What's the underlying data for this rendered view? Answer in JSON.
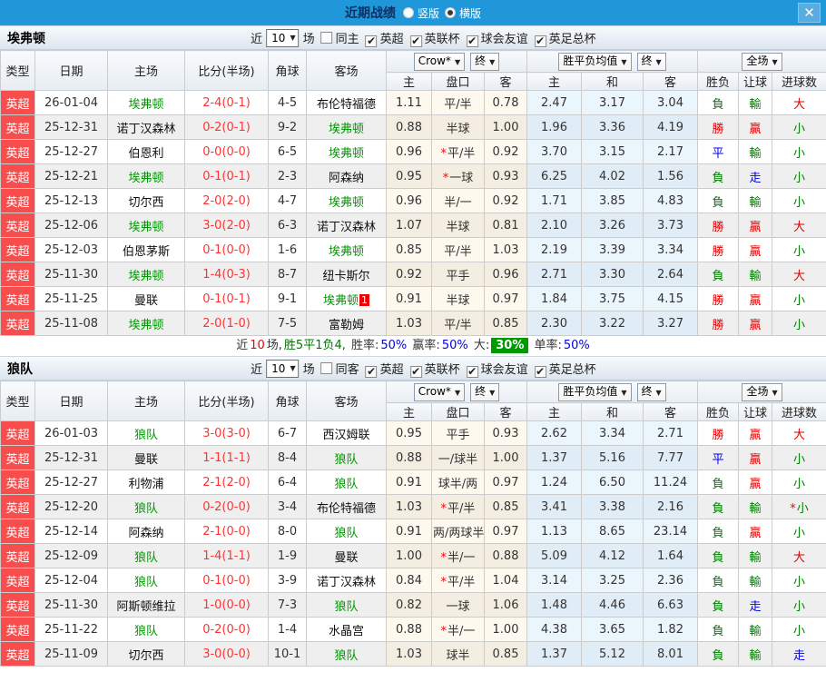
{
  "titlebar": {
    "title": "近期战绩",
    "vertical_label": "竖版",
    "horizontal_label": "横版",
    "selected_layout": "横版"
  },
  "glyphs": {
    "dropdown_arrow": "▼",
    "check": "✔",
    "close": "✕"
  },
  "filters": {
    "near_label": "近",
    "games_label": "场"
  },
  "table_header": {
    "type": "类型",
    "date": "日期",
    "home": "主场",
    "score": "比分(半场)",
    "corner": "角球",
    "away": "客场",
    "odds_source": "Crow*",
    "final_label": "终",
    "avg_label": "胜平负均值",
    "full_label": "全场",
    "home_odds": "主",
    "handicap": "盘口",
    "away_odds": "客",
    "home_avg": "主",
    "draw_avg": "和",
    "away_avg": "客",
    "result": "胜负",
    "handicap_result": "让球",
    "goals": "进球数"
  },
  "colors": {
    "titlebar_blue": "#1f97d8",
    "type_red": "#f84d4d",
    "focus_team": "#009900",
    "score_red": "#ff3333",
    "result_colors": {
      "勝": "#e60000",
      "贏": "#e60000",
      "大": "#e60000",
      "平": "#0000ee",
      "走": "#0000ee",
      "負": "#008000",
      "輸": "#008000",
      "小": "#008000"
    }
  },
  "sections": [
    {
      "team": "埃弗顿",
      "games_count": "10",
      "same_label": "同主",
      "same_checked": false,
      "leagues": [
        "英超",
        "英联杯",
        "球会友谊",
        "英足总杯"
      ],
      "rows": [
        {
          "t": "英超",
          "d": "26-01-04",
          "h": "埃弗顿",
          "hf": true,
          "s": "2-4(0-1)",
          "c": "4-5",
          "a": "布伦特福德",
          "af": false,
          "o1": "1.11",
          "hc": "平/半",
          "hs": false,
          "o2": "0.78",
          "m1": "2.47",
          "m2": "3.17",
          "m3": "3.04",
          "r1": "負",
          "r2": "輸",
          "r3": "大",
          "r3s": false
        },
        {
          "t": "英超",
          "d": "25-12-31",
          "h": "诺丁汉森林",
          "hf": false,
          "s": "0-2(0-1)",
          "c": "9-2",
          "a": "埃弗顿",
          "af": true,
          "o1": "0.88",
          "hc": "半球",
          "hs": false,
          "o2": "1.00",
          "m1": "1.96",
          "m2": "3.36",
          "m3": "4.19",
          "r1": "勝",
          "r2": "贏",
          "r3": "小",
          "r3s": false
        },
        {
          "t": "英超",
          "d": "25-12-27",
          "h": "伯恩利",
          "hf": false,
          "s": "0-0(0-0)",
          "c": "6-5",
          "a": "埃弗顿",
          "af": true,
          "o1": "0.96",
          "hc": "平/半",
          "hs": true,
          "o2": "0.92",
          "m1": "3.70",
          "m2": "3.15",
          "m3": "2.17",
          "r1": "平",
          "r2": "輸",
          "r3": "小",
          "r3s": false
        },
        {
          "t": "英超",
          "d": "25-12-21",
          "h": "埃弗顿",
          "hf": true,
          "s": "0-1(0-1)",
          "c": "2-3",
          "a": "阿森纳",
          "af": false,
          "o1": "0.95",
          "hc": "一球",
          "hs": true,
          "o2": "0.93",
          "m1": "6.25",
          "m2": "4.02",
          "m3": "1.56",
          "r1": "負",
          "r2": "走",
          "r3": "小",
          "r3s": false
        },
        {
          "t": "英超",
          "d": "25-12-13",
          "h": "切尔西",
          "hf": false,
          "s": "2-0(2-0)",
          "c": "4-7",
          "a": "埃弗顿",
          "af": true,
          "o1": "0.96",
          "hc": "半/一",
          "hs": false,
          "o2": "0.92",
          "m1": "1.71",
          "m2": "3.85",
          "m3": "4.83",
          "r1": "負",
          "r2": "輸",
          "r3": "小",
          "r3s": false
        },
        {
          "t": "英超",
          "d": "25-12-06",
          "h": "埃弗顿",
          "hf": true,
          "s": "3-0(2-0)",
          "c": "6-3",
          "a": "诺丁汉森林",
          "af": false,
          "o1": "1.07",
          "hc": "半球",
          "hs": false,
          "o2": "0.81",
          "m1": "2.10",
          "m2": "3.26",
          "m3": "3.73",
          "r1": "勝",
          "r2": "贏",
          "r3": "大",
          "r3s": false
        },
        {
          "t": "英超",
          "d": "25-12-03",
          "h": "伯恩茅斯",
          "hf": false,
          "s": "0-1(0-0)",
          "c": "1-6",
          "a": "埃弗顿",
          "af": true,
          "o1": "0.85",
          "hc": "平/半",
          "hs": false,
          "o2": "1.03",
          "m1": "2.19",
          "m2": "3.39",
          "m3": "3.34",
          "r1": "勝",
          "r2": "贏",
          "r3": "小",
          "r3s": false
        },
        {
          "t": "英超",
          "d": "25-11-30",
          "h": "埃弗顿",
          "hf": true,
          "s": "1-4(0-3)",
          "c": "8-7",
          "a": "纽卡斯尔",
          "af": false,
          "o1": "0.92",
          "hc": "平手",
          "hs": false,
          "o2": "0.96",
          "m1": "2.71",
          "m2": "3.30",
          "m3": "2.64",
          "r1": "負",
          "r2": "輸",
          "r3": "大",
          "r3s": false
        },
        {
          "t": "英超",
          "d": "25-11-25",
          "h": "曼联",
          "hf": false,
          "s": "0-1(0-1)",
          "c": "9-1",
          "a": "埃弗顿",
          "af": true,
          "ab": "1",
          "o1": "0.91",
          "hc": "半球",
          "hs": false,
          "o2": "0.97",
          "m1": "1.84",
          "m2": "3.75",
          "m3": "4.15",
          "r1": "勝",
          "r2": "贏",
          "r3": "小",
          "r3s": false
        },
        {
          "t": "英超",
          "d": "25-11-08",
          "h": "埃弗顿",
          "hf": true,
          "s": "2-0(1-0)",
          "c": "7-5",
          "a": "富勒姆",
          "af": false,
          "o1": "1.03",
          "hc": "平/半",
          "hs": false,
          "o2": "0.85",
          "m1": "2.30",
          "m2": "3.22",
          "m3": "3.27",
          "r1": "勝",
          "r2": "贏",
          "r3": "小",
          "r3s": false
        }
      ],
      "summary": [
        {
          "text": "近",
          "color": "#333333"
        },
        {
          "text": "10",
          "color": "#ee0000"
        },
        {
          "text": "场,",
          "color": "#333333"
        },
        {
          "text": "胜5平1负4,",
          "color": "#007700"
        },
        {
          "text": " 胜率:",
          "color": "#333333"
        },
        {
          "text": "50%",
          "color": "#0000ee"
        },
        {
          "text": " 赢率:",
          "color": "#333333"
        },
        {
          "text": "50%",
          "color": "#0000ee"
        },
        {
          "text": " 大:",
          "color": "#333333"
        },
        {
          "text": "30%",
          "color": "#ffffff",
          "bg": "#009900"
        },
        {
          "text": " 单率:",
          "color": "#333333"
        },
        {
          "text": "50%",
          "color": "#0000ee"
        }
      ]
    },
    {
      "team": "狼队",
      "games_count": "10",
      "same_label": "同客",
      "same_checked": false,
      "leagues": [
        "英超",
        "英联杯",
        "球会友谊",
        "英足总杯"
      ],
      "rows": [
        {
          "t": "英超",
          "d": "26-01-03",
          "h": "狼队",
          "hf": true,
          "s": "3-0(3-0)",
          "c": "6-7",
          "a": "西汉姆联",
          "af": false,
          "o1": "0.95",
          "hc": "平手",
          "hs": false,
          "o2": "0.93",
          "m1": "2.62",
          "m2": "3.34",
          "m3": "2.71",
          "r1": "勝",
          "r2": "贏",
          "r3": "大",
          "r3s": false
        },
        {
          "t": "英超",
          "d": "25-12-31",
          "h": "曼联",
          "hf": false,
          "s": "1-1(1-1)",
          "c": "8-4",
          "a": "狼队",
          "af": true,
          "o1": "0.88",
          "hc": "一/球半",
          "hs": false,
          "o2": "1.00",
          "m1": "1.37",
          "m2": "5.16",
          "m3": "7.77",
          "r1": "平",
          "r2": "贏",
          "r3": "小",
          "r3s": false
        },
        {
          "t": "英超",
          "d": "25-12-27",
          "h": "利物浦",
          "hf": false,
          "s": "2-1(2-0)",
          "c": "6-4",
          "a": "狼队",
          "af": true,
          "o1": "0.91",
          "hc": "球半/两",
          "hs": false,
          "o2": "0.97",
          "m1": "1.24",
          "m2": "6.50",
          "m3": "11.24",
          "r1": "負",
          "r2": "贏",
          "r3": "小",
          "r3s": false
        },
        {
          "t": "英超",
          "d": "25-12-20",
          "h": "狼队",
          "hf": true,
          "s": "0-2(0-0)",
          "c": "3-4",
          "a": "布伦特福德",
          "af": false,
          "o1": "1.03",
          "hc": "平/半",
          "hs": true,
          "o2": "0.85",
          "m1": "3.41",
          "m2": "3.38",
          "m3": "2.16",
          "r1": "負",
          "r2": "輸",
          "r3": "小",
          "r3s": true
        },
        {
          "t": "英超",
          "d": "25-12-14",
          "h": "阿森纳",
          "hf": false,
          "s": "2-1(0-0)",
          "c": "8-0",
          "a": "狼队",
          "af": true,
          "o1": "0.91",
          "hc": "两/两球半",
          "hs": false,
          "o2": "0.97",
          "m1": "1.13",
          "m2": "8.65",
          "m3": "23.14",
          "r1": "負",
          "r2": "贏",
          "r3": "小",
          "r3s": false
        },
        {
          "t": "英超",
          "d": "25-12-09",
          "h": "狼队",
          "hf": true,
          "s": "1-4(1-1)",
          "c": "1-9",
          "a": "曼联",
          "af": false,
          "o1": "1.00",
          "hc": "半/一",
          "hs": true,
          "o2": "0.88",
          "m1": "5.09",
          "m2": "4.12",
          "m3": "1.64",
          "r1": "負",
          "r2": "輸",
          "r3": "大",
          "r3s": false
        },
        {
          "t": "英超",
          "d": "25-12-04",
          "h": "狼队",
          "hf": true,
          "s": "0-1(0-0)",
          "c": "3-9",
          "a": "诺丁汉森林",
          "af": false,
          "o1": "0.84",
          "hc": "平/半",
          "hs": true,
          "o2": "1.04",
          "m1": "3.14",
          "m2": "3.25",
          "m3": "2.36",
          "r1": "負",
          "r2": "輸",
          "r3": "小",
          "r3s": false
        },
        {
          "t": "英超",
          "d": "25-11-30",
          "h": "阿斯顿维拉",
          "hf": false,
          "s": "1-0(0-0)",
          "c": "7-3",
          "a": "狼队",
          "af": true,
          "o1": "0.82",
          "hc": "一球",
          "hs": false,
          "o2": "1.06",
          "m1": "1.48",
          "m2": "4.46",
          "m3": "6.63",
          "r1": "負",
          "r2": "走",
          "r3": "小",
          "r3s": false
        },
        {
          "t": "英超",
          "d": "25-11-22",
          "h": "狼队",
          "hf": true,
          "s": "0-2(0-0)",
          "c": "1-4",
          "a": "水晶宫",
          "af": false,
          "o1": "0.88",
          "hc": "半/一",
          "hs": true,
          "o2": "1.00",
          "m1": "4.38",
          "m2": "3.65",
          "m3": "1.82",
          "r1": "負",
          "r2": "輸",
          "r3": "小",
          "r3s": false
        },
        {
          "t": "英超",
          "d": "25-11-09",
          "h": "切尔西",
          "hf": false,
          "s": "3-0(0-0)",
          "c": "10-1",
          "a": "狼队",
          "af": true,
          "o1": "1.03",
          "hc": "球半",
          "hs": false,
          "o2": "0.85",
          "m1": "1.37",
          "m2": "5.12",
          "m3": "8.01",
          "r1": "負",
          "r2": "輸",
          "r3": "走",
          "r3s": false
        }
      ]
    }
  ]
}
